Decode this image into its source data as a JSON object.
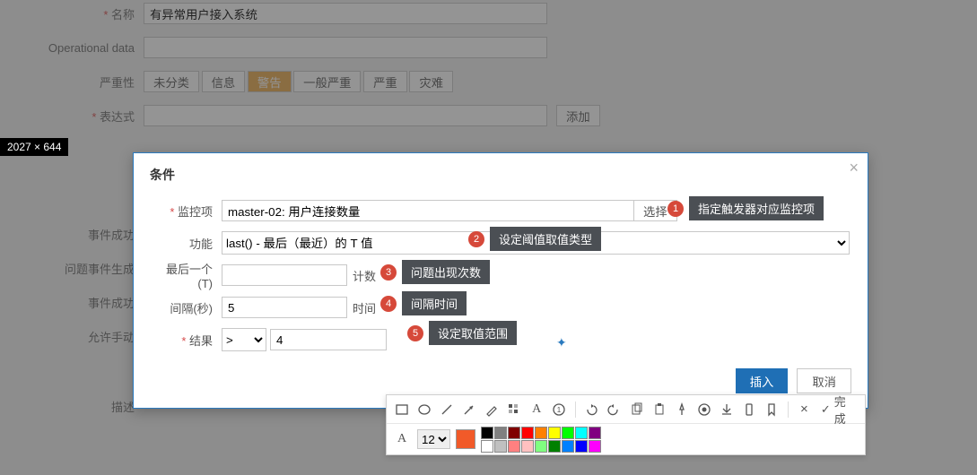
{
  "bg": {
    "name_label": "名称",
    "name_value": "有异常用户接入系统",
    "opdata_label": "Operational data",
    "opdata_value": "",
    "severity_label": "严重性",
    "severity_options": [
      "未分类",
      "信息",
      "警告",
      "一般严重",
      "严重",
      "灾难"
    ],
    "severity_active": "警告",
    "expr_label": "表达式",
    "expr_value": "",
    "add_btn": "添加",
    "side_labels": [
      "事件成功",
      "问题事件生成",
      "事件成功",
      "允许手动",
      "描述"
    ]
  },
  "dim_tag": "2027 × 644",
  "modal": {
    "title": "条件",
    "close": "×",
    "monitor_label": "监控项",
    "monitor_value": "master-02: 用户连接数量",
    "choose_btn": "选择",
    "func_label": "功能",
    "func_value": "last() - 最后（最近）的 T 值",
    "last_label": "最后一个 (T)",
    "last_value": "",
    "last_after": "计数",
    "interval_label": "间隔(秒)",
    "interval_value": "5",
    "interval_after": "时间",
    "result_label": "结果",
    "op_value": ">",
    "result_value": "4",
    "insert_btn": "插入",
    "cancel_btn": "取消"
  },
  "annotations": {
    "a1": "指定触发器对应监控项",
    "a2": "设定阈值取值类型",
    "a3": "问题出现次数",
    "a4": "间隔时间",
    "a5": "设定取值范围"
  },
  "editor": {
    "done": "完成",
    "fontsize": "12",
    "main_color": "#f15a29",
    "palette": [
      "#000000",
      "#808080",
      "#800000",
      "#ff0000",
      "#ff8000",
      "#ffff00",
      "#00ff00",
      "#00ffff",
      "#800080",
      "#ffffff",
      "#c0c0c0",
      "#ff8080",
      "#ffc0c0",
      "#80ff80",
      "#008000",
      "#0080ff",
      "#0000ff",
      "#ff00ff"
    ],
    "icons": {
      "rect": "rect-icon",
      "ellipse": "ellipse-icon",
      "line": "line-icon",
      "arrow": "arrow-icon",
      "pencil": "pencil-icon",
      "mosaic": "mosaic-icon",
      "text": "text-icon",
      "number": "number-icon",
      "undo": "undo-icon",
      "redo": "redo-icon",
      "copy": "copy-icon",
      "paste": "paste-icon",
      "pin": "pin-icon",
      "record": "record-icon",
      "download": "download-icon",
      "phone": "phone-icon",
      "bookmark": "bookmark-icon",
      "close": "close-icon",
      "check": "check-icon"
    }
  }
}
